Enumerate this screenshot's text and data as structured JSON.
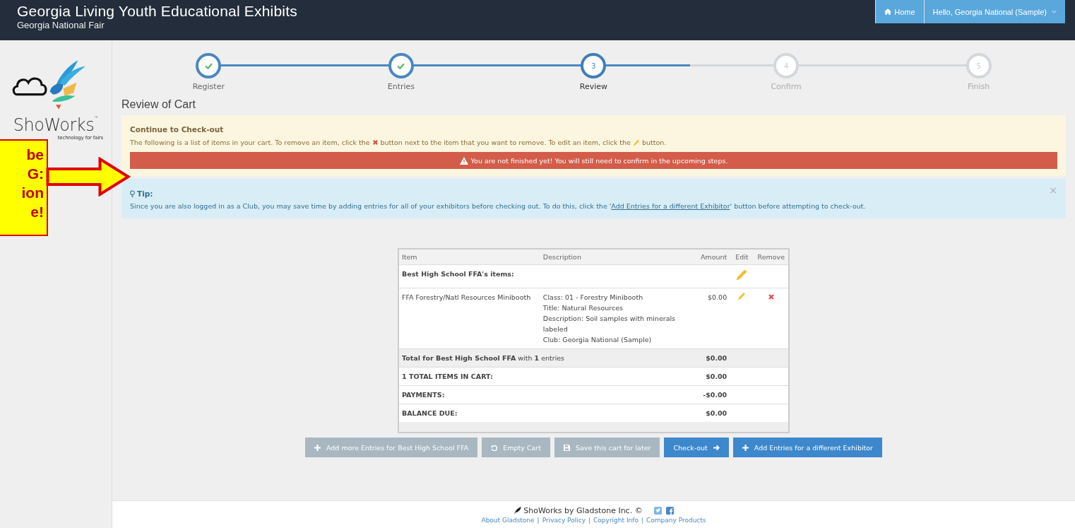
{
  "header": {
    "title": "Georgia Living Youth Educational Exhibits",
    "subtitle": "Georgia National Fair",
    "nav": [
      {
        "kind": "home",
        "label": "Home"
      },
      {
        "kind": "user",
        "label": "Hello, Georgia National (Sample)"
      }
    ]
  },
  "logo": {
    "name": "ShoWorks",
    "tm": "™",
    "tagline": "technology for fairs"
  },
  "steps": [
    {
      "label": "Register",
      "completed": true,
      "selected": false
    },
    {
      "label": "Entries",
      "completed": true,
      "selected": false
    },
    {
      "label": "Review",
      "number": "3",
      "completed": false,
      "selected": true
    },
    {
      "label": "Confirm",
      "number": "4",
      "completed": false,
      "selected": false
    },
    {
      "label": "Finish",
      "number": "5",
      "completed": false,
      "selected": false
    }
  ],
  "page_title": "Review of Cart",
  "notice": {
    "title": "Continue to Check-out",
    "parts": [
      {
        "kind": "text",
        "text": "The following is a list of items in your cart. To remove an item, click the"
      },
      {
        "kind": "remove"
      },
      {
        "kind": "text",
        "text": "button next to the item that you want to remove. To edit an item, click the"
      },
      {
        "kind": "edit"
      },
      {
        "kind": "text",
        "text": "button."
      }
    ],
    "warning": "You are not finished yet! You will still need to confirm in the upcoming steps."
  },
  "tip": {
    "title": "Tip:",
    "before": "Since you are also logged in as a Club, you may save time by adding entries for all of your exhibitors before checking out. To do this, click the '",
    "link": "Add Entries for a different Exhibitor",
    "after": "' button before attempting to check-out.",
    "close": "×"
  },
  "table": {
    "columns": [
      "Item",
      "Description",
      "Amount",
      "Edit",
      "Remove"
    ],
    "group": {
      "label": "Best High School FFA's items:",
      "editable": true
    },
    "items": [
      {
        "item": "FFA Forestry/Natl Resources Minibooth",
        "description": [
          "Class: 01 - Forestry Minibooth",
          "Title: Natural Resources",
          "Description: Soil samples with minerals labeled",
          "Club: Georgia National (Sample)"
        ],
        "amount": "$0.00",
        "editable": true,
        "removable": true
      }
    ],
    "total": {
      "label": "**Total for Best High School FFA** with **1** entries",
      "amount": "$0.00"
    },
    "summary": [
      {
        "label": "1 TOTAL ITEMS IN CART:",
        "amount": "$0.00"
      },
      {
        "label": "PAYMENTS:",
        "amount": "-$0.00"
      },
      {
        "label": "BALANCE DUE:",
        "amount": "$0.00"
      }
    ]
  },
  "buttons": [
    {
      "label": "Add more Entries for Best High School FFA",
      "kind": "add",
      "disabled": true
    },
    {
      "label": "Empty Cart",
      "kind": "empty",
      "disabled": true
    },
    {
      "label": "Save this cart for later",
      "kind": "save",
      "disabled": true
    },
    {
      "label": "Check-out",
      "kind": "checkout",
      "disabled": false
    },
    {
      "label": "Add Entries for a different Exhibitor",
      "kind": "add",
      "disabled": false
    }
  ],
  "footer": {
    "brand": "ShoWorks by Gladstone Inc. ©",
    "links": [
      "About Gladstone",
      "Privacy Policy",
      "Copyright Info",
      "Company Products"
    ],
    "separator": "|"
  },
  "callout": {
    "lines": [
      "be",
      "G:",
      "ion",
      "e!"
    ]
  }
}
